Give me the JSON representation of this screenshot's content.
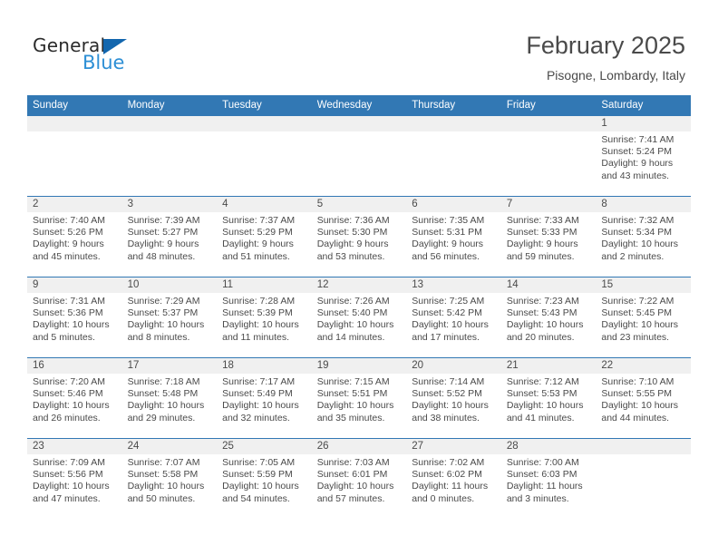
{
  "brand": {
    "name_part1": "General",
    "name_part2": "Blue",
    "triangle_color": "#1266ae",
    "blue_color": "#2d8fd5"
  },
  "header": {
    "month_title": "February 2025",
    "location": "Pisogne, Lombardy, Italy"
  },
  "theme": {
    "header_blue": "#3278b4",
    "daynum_band": "#f0f0f0",
    "text": "#4a4a4a"
  },
  "weekdays": [
    "Sunday",
    "Monday",
    "Tuesday",
    "Wednesday",
    "Thursday",
    "Friday",
    "Saturday"
  ],
  "labels": {
    "sunrise": "Sunrise:",
    "sunset": "Sunset:",
    "daylight": "Daylight:"
  },
  "weeks": [
    [
      {
        "day": "",
        "blank": true
      },
      {
        "day": "",
        "blank": true
      },
      {
        "day": "",
        "blank": true
      },
      {
        "day": "",
        "blank": true
      },
      {
        "day": "",
        "blank": true
      },
      {
        "day": "",
        "blank": true
      },
      {
        "day": "1",
        "sunrise": "Sunrise: 7:41 AM",
        "sunset": "Sunset: 5:24 PM",
        "daylight1": "Daylight: 9 hours",
        "daylight2": "and 43 minutes."
      }
    ],
    [
      {
        "day": "2",
        "sunrise": "Sunrise: 7:40 AM",
        "sunset": "Sunset: 5:26 PM",
        "daylight1": "Daylight: 9 hours",
        "daylight2": "and 45 minutes."
      },
      {
        "day": "3",
        "sunrise": "Sunrise: 7:39 AM",
        "sunset": "Sunset: 5:27 PM",
        "daylight1": "Daylight: 9 hours",
        "daylight2": "and 48 minutes."
      },
      {
        "day": "4",
        "sunrise": "Sunrise: 7:37 AM",
        "sunset": "Sunset: 5:29 PM",
        "daylight1": "Daylight: 9 hours",
        "daylight2": "and 51 minutes."
      },
      {
        "day": "5",
        "sunrise": "Sunrise: 7:36 AM",
        "sunset": "Sunset: 5:30 PM",
        "daylight1": "Daylight: 9 hours",
        "daylight2": "and 53 minutes."
      },
      {
        "day": "6",
        "sunrise": "Sunrise: 7:35 AM",
        "sunset": "Sunset: 5:31 PM",
        "daylight1": "Daylight: 9 hours",
        "daylight2": "and 56 minutes."
      },
      {
        "day": "7",
        "sunrise": "Sunrise: 7:33 AM",
        "sunset": "Sunset: 5:33 PM",
        "daylight1": "Daylight: 9 hours",
        "daylight2": "and 59 minutes."
      },
      {
        "day": "8",
        "sunrise": "Sunrise: 7:32 AM",
        "sunset": "Sunset: 5:34 PM",
        "daylight1": "Daylight: 10 hours",
        "daylight2": "and 2 minutes."
      }
    ],
    [
      {
        "day": "9",
        "sunrise": "Sunrise: 7:31 AM",
        "sunset": "Sunset: 5:36 PM",
        "daylight1": "Daylight: 10 hours",
        "daylight2": "and 5 minutes."
      },
      {
        "day": "10",
        "sunrise": "Sunrise: 7:29 AM",
        "sunset": "Sunset: 5:37 PM",
        "daylight1": "Daylight: 10 hours",
        "daylight2": "and 8 minutes."
      },
      {
        "day": "11",
        "sunrise": "Sunrise: 7:28 AM",
        "sunset": "Sunset: 5:39 PM",
        "daylight1": "Daylight: 10 hours",
        "daylight2": "and 11 minutes."
      },
      {
        "day": "12",
        "sunrise": "Sunrise: 7:26 AM",
        "sunset": "Sunset: 5:40 PM",
        "daylight1": "Daylight: 10 hours",
        "daylight2": "and 14 minutes."
      },
      {
        "day": "13",
        "sunrise": "Sunrise: 7:25 AM",
        "sunset": "Sunset: 5:42 PM",
        "daylight1": "Daylight: 10 hours",
        "daylight2": "and 17 minutes."
      },
      {
        "day": "14",
        "sunrise": "Sunrise: 7:23 AM",
        "sunset": "Sunset: 5:43 PM",
        "daylight1": "Daylight: 10 hours",
        "daylight2": "and 20 minutes."
      },
      {
        "day": "15",
        "sunrise": "Sunrise: 7:22 AM",
        "sunset": "Sunset: 5:45 PM",
        "daylight1": "Daylight: 10 hours",
        "daylight2": "and 23 minutes."
      }
    ],
    [
      {
        "day": "16",
        "sunrise": "Sunrise: 7:20 AM",
        "sunset": "Sunset: 5:46 PM",
        "daylight1": "Daylight: 10 hours",
        "daylight2": "and 26 minutes."
      },
      {
        "day": "17",
        "sunrise": "Sunrise: 7:18 AM",
        "sunset": "Sunset: 5:48 PM",
        "daylight1": "Daylight: 10 hours",
        "daylight2": "and 29 minutes."
      },
      {
        "day": "18",
        "sunrise": "Sunrise: 7:17 AM",
        "sunset": "Sunset: 5:49 PM",
        "daylight1": "Daylight: 10 hours",
        "daylight2": "and 32 minutes."
      },
      {
        "day": "19",
        "sunrise": "Sunrise: 7:15 AM",
        "sunset": "Sunset: 5:51 PM",
        "daylight1": "Daylight: 10 hours",
        "daylight2": "and 35 minutes."
      },
      {
        "day": "20",
        "sunrise": "Sunrise: 7:14 AM",
        "sunset": "Sunset: 5:52 PM",
        "daylight1": "Daylight: 10 hours",
        "daylight2": "and 38 minutes."
      },
      {
        "day": "21",
        "sunrise": "Sunrise: 7:12 AM",
        "sunset": "Sunset: 5:53 PM",
        "daylight1": "Daylight: 10 hours",
        "daylight2": "and 41 minutes."
      },
      {
        "day": "22",
        "sunrise": "Sunrise: 7:10 AM",
        "sunset": "Sunset: 5:55 PM",
        "daylight1": "Daylight: 10 hours",
        "daylight2": "and 44 minutes."
      }
    ],
    [
      {
        "day": "23",
        "sunrise": "Sunrise: 7:09 AM",
        "sunset": "Sunset: 5:56 PM",
        "daylight1": "Daylight: 10 hours",
        "daylight2": "and 47 minutes."
      },
      {
        "day": "24",
        "sunrise": "Sunrise: 7:07 AM",
        "sunset": "Sunset: 5:58 PM",
        "daylight1": "Daylight: 10 hours",
        "daylight2": "and 50 minutes."
      },
      {
        "day": "25",
        "sunrise": "Sunrise: 7:05 AM",
        "sunset": "Sunset: 5:59 PM",
        "daylight1": "Daylight: 10 hours",
        "daylight2": "and 54 minutes."
      },
      {
        "day": "26",
        "sunrise": "Sunrise: 7:03 AM",
        "sunset": "Sunset: 6:01 PM",
        "daylight1": "Daylight: 10 hours",
        "daylight2": "and 57 minutes."
      },
      {
        "day": "27",
        "sunrise": "Sunrise: 7:02 AM",
        "sunset": "Sunset: 6:02 PM",
        "daylight1": "Daylight: 11 hours",
        "daylight2": "and 0 minutes."
      },
      {
        "day": "28",
        "sunrise": "Sunrise: 7:00 AM",
        "sunset": "Sunset: 6:03 PM",
        "daylight1": "Daylight: 11 hours",
        "daylight2": "and 3 minutes."
      },
      {
        "day": "",
        "blank": true
      }
    ]
  ]
}
